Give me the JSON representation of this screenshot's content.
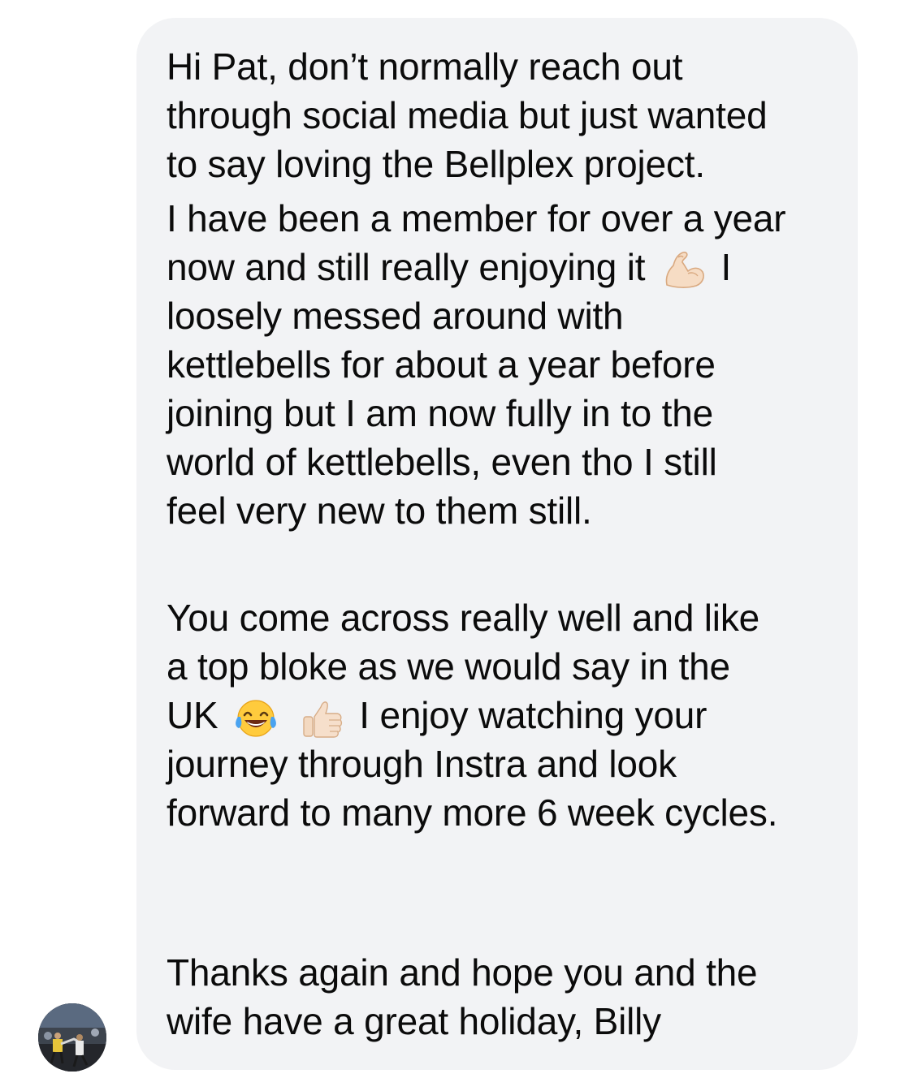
{
  "message": {
    "paragraph1": {
      "line1": "Hi Pat, don’t normally reach out",
      "line2": "through social media but just wanted",
      "line3": "to say loving the Bellplex project."
    },
    "paragraph2": {
      "line1": "I have been a member for over a year",
      "line2_before_emoji": "now and still really enjoying it",
      "line2_after_emoji": "I",
      "line3": "loosely messed around with",
      "line4": "kettlebells for about a year before",
      "line5": "joining but I am now fully in to the",
      "line6": "world of kettlebells, even tho I still",
      "line7": "feel very new to them still."
    },
    "paragraph3": {
      "line1": "You come across really well and like",
      "line2": "a top bloke as we would say in the",
      "line3_before_emoji": "UK",
      "line3_after_emoji": "I enjoy watching your",
      "line4": "journey through Instra and look",
      "line5": "forward to many more 6 week cycles."
    },
    "paragraph4": {
      "line1": "Thanks again and hope you and the",
      "line2": "wife have a great holiday, Billy"
    },
    "emojis": [
      "flexed-biceps-icon",
      "tears-of-joy-icon",
      "thumbs-up-icon"
    ]
  },
  "colors": {
    "bubble_background": "#f2f3f5",
    "text": "#0b0b0b",
    "page_background": "#ffffff"
  }
}
